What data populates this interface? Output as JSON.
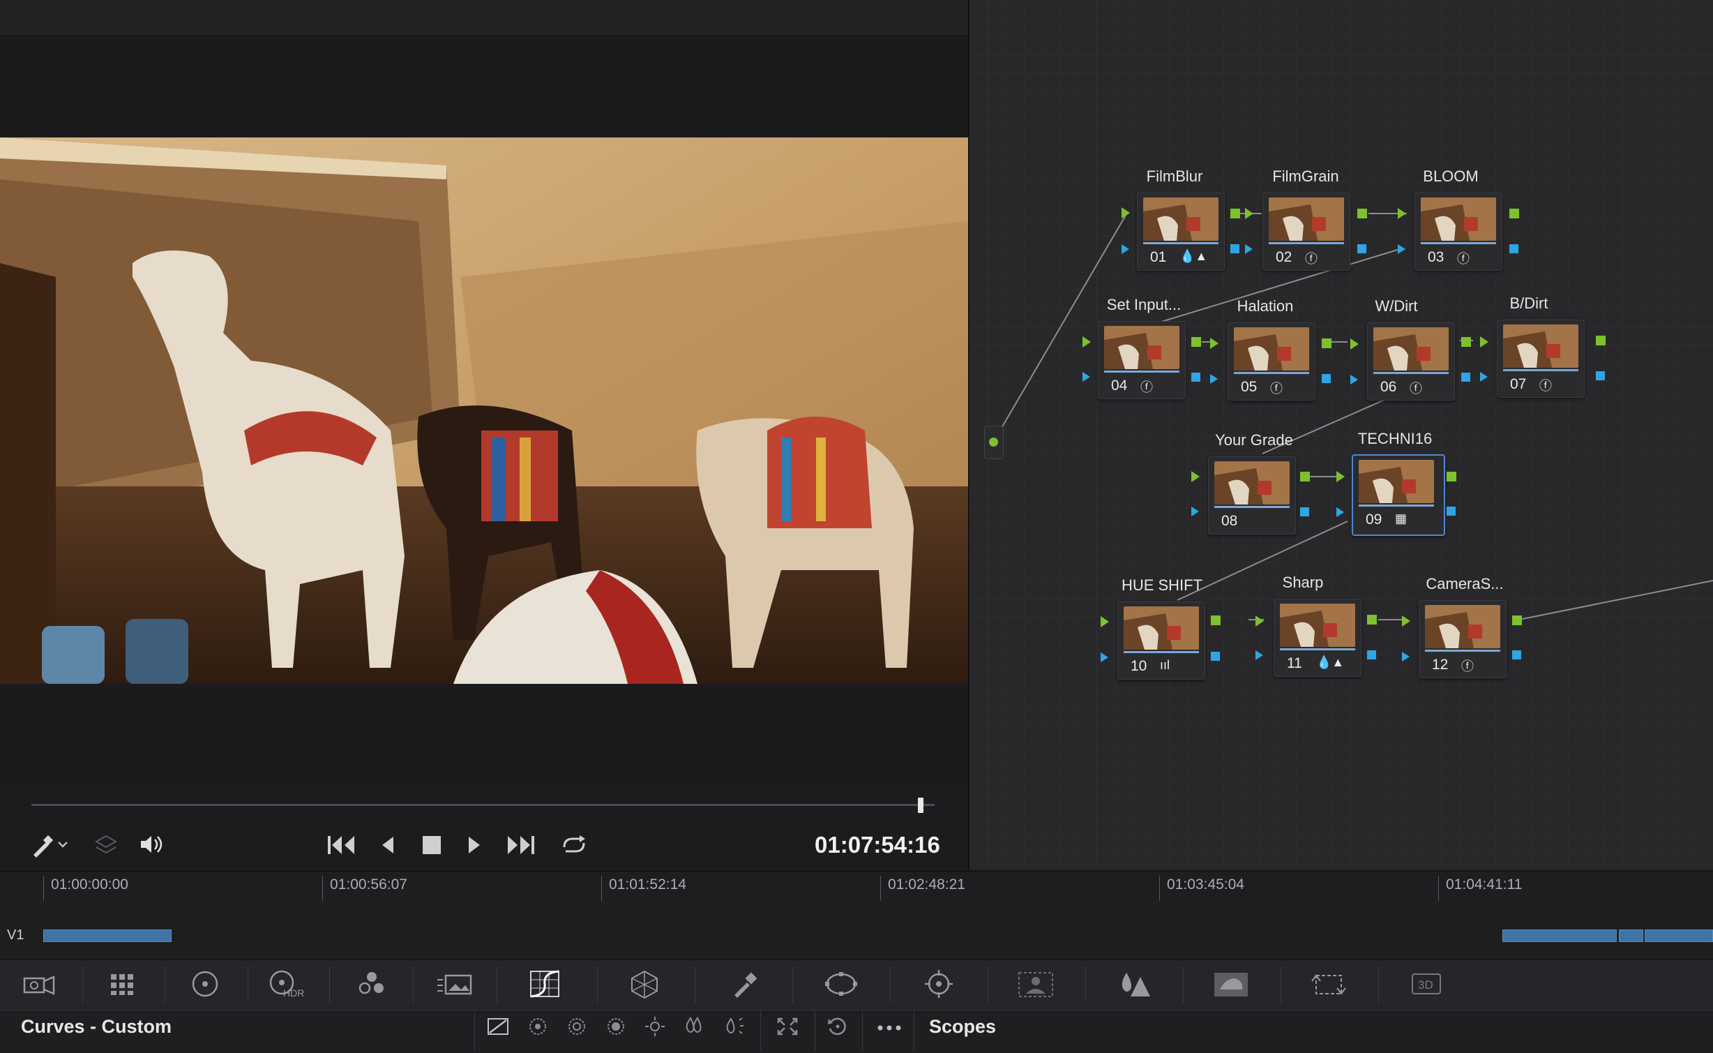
{
  "viewer": {
    "timecode": "01:07:54:16",
    "playhead_fraction": 0.98
  },
  "transport": {
    "picker_icon": "color-picker-icon",
    "layers_icon": "layers-icon",
    "volume_icon": "volume-icon",
    "buttons": [
      "skip-to-start",
      "step-back",
      "stop",
      "play",
      "skip-to-end",
      "loop"
    ]
  },
  "nodes": {
    "n01": {
      "label": "FilmBlur",
      "num": "01",
      "icon": "💧▲"
    },
    "n02": {
      "label": "FilmGrain",
      "num": "02",
      "icon": "ⓕ"
    },
    "n03": {
      "label": "BLOOM",
      "num": "03",
      "icon": "ⓕ"
    },
    "n04": {
      "label": "Set Input...",
      "num": "04",
      "icon": "ⓕ"
    },
    "n05": {
      "label": "Halation",
      "num": "05",
      "icon": "ⓕ"
    },
    "n06": {
      "label": "W/Dirt",
      "num": "06",
      "icon": "ⓕ"
    },
    "n07": {
      "label": "B/Dirt",
      "num": "07",
      "icon": "ⓕ"
    },
    "n08": {
      "label": "Your Grade",
      "num": "08",
      "icon": ""
    },
    "n09": {
      "label": "TECHNI16",
      "num": "09",
      "icon": "▦"
    },
    "n10": {
      "label": "HUE SHIFT",
      "num": "10",
      "icon": "ııl"
    },
    "n11": {
      "label": "Sharp",
      "num": "11",
      "icon": "💧▲"
    },
    "n12": {
      "label": "CameraS...",
      "num": "12",
      "icon": "ⓕ"
    }
  },
  "timeline": {
    "track": "V1",
    "marks": [
      "01:00:00:00",
      "01:00:56:07",
      "01:01:52:14",
      "01:02:48:21",
      "01:03:45:04",
      "01:04:41:11"
    ]
  },
  "palette": {
    "items": [
      "camera-raw",
      "color-match",
      "primaries-wheels",
      "hdr",
      "rgb-mixer",
      "motion-effects",
      "curves",
      "color-warper",
      "qualifier",
      "window",
      "tracker",
      "magic-mask",
      "blur",
      "key",
      "sizing",
      "3d"
    ],
    "hdr_label": "HDR",
    "three_d_label": "3D"
  },
  "bottom": {
    "left_title": "Curves - Custom",
    "right_title": "Scopes",
    "tools": [
      "custom-curve",
      "hue-vs-hue",
      "hue-vs-sat",
      "hue-vs-lum",
      "lum-vs-sat",
      "sat-vs-sat",
      "sat-vs-lum",
      "expand",
      "reset",
      "more"
    ]
  }
}
